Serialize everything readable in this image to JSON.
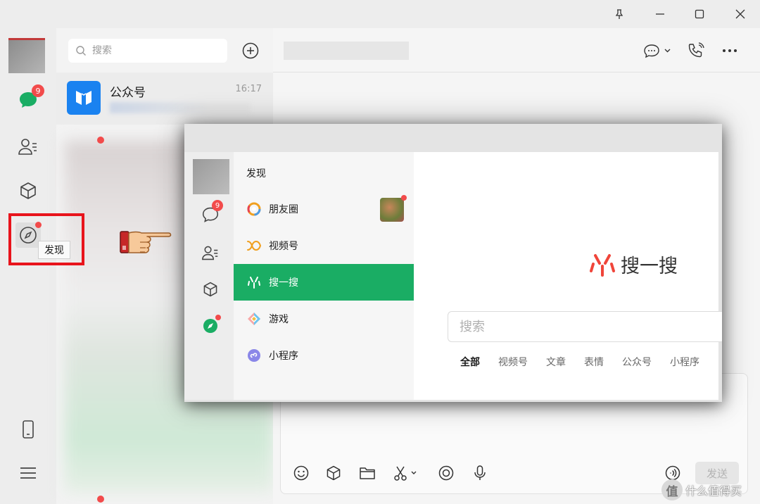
{
  "window": {
    "controls": [
      "pin-icon",
      "minimize-icon",
      "maximize-icon",
      "close-icon"
    ]
  },
  "rail": {
    "chat_badge": "9",
    "tooltip": "发现"
  },
  "chatlist": {
    "search_placeholder": "搜索",
    "conversation": {
      "name": "公众号",
      "time": "16:17"
    }
  },
  "main": {
    "send_label": "发送",
    "watermark": "什么值得买",
    "watermark_mark": "值"
  },
  "inset": {
    "rail_badge": "9",
    "menu_title": "发现",
    "menu_items": [
      {
        "label": "朋友圈",
        "icon": "moments-icon"
      },
      {
        "label": "视频号",
        "icon": "channels-icon"
      },
      {
        "label": "搜一搜",
        "icon": "search-search-icon",
        "active": true
      },
      {
        "label": "游戏",
        "icon": "games-icon"
      },
      {
        "label": "小程序",
        "icon": "mini-program-icon"
      }
    ],
    "search_title": "搜一搜",
    "search_placeholder": "搜索",
    "tabs": [
      "全部",
      "视频号",
      "文章",
      "表情",
      "公众号",
      "小程序"
    ]
  },
  "colors": {
    "accent_green": "#1aad64",
    "badge_red": "#f24b4b",
    "highlight_red": "#e8141c",
    "official_blue": "#1a82f0"
  }
}
